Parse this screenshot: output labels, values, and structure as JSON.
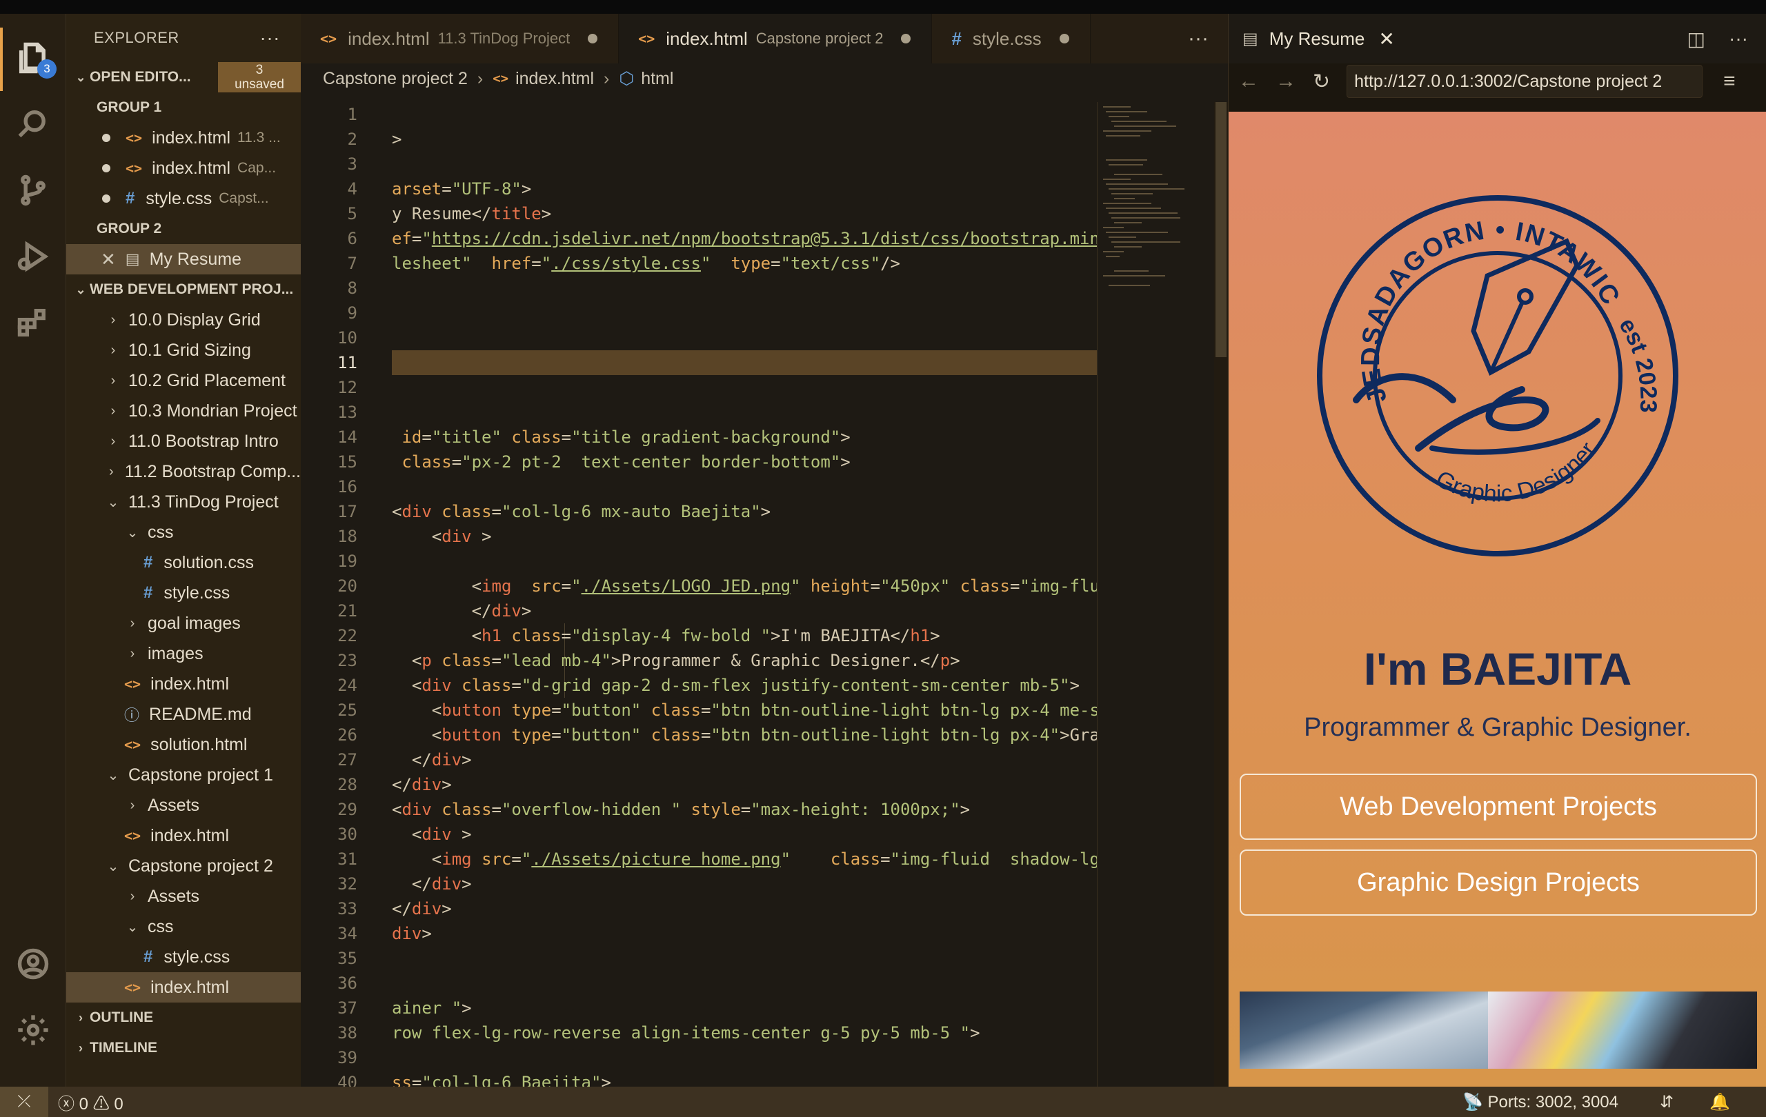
{
  "sidebar": {
    "title": "EXPLORER",
    "open_editors": {
      "label": "OPEN EDITO...",
      "unsaved_count": "3",
      "unsaved_label": "unsaved"
    },
    "group1": {
      "label": "GROUP 1",
      "items": [
        {
          "name": "index.html",
          "desc": "11.3 ..."
        },
        {
          "name": "index.html",
          "desc": "Cap..."
        },
        {
          "name": "style.css",
          "desc": "Capst..."
        }
      ]
    },
    "group2": {
      "label": "GROUP 2",
      "items": [
        {
          "name": "My Resume"
        }
      ]
    },
    "project": {
      "label": "WEB DEVELOPMENT PROJ..."
    },
    "tree": [
      "10.0 Display Grid",
      "10.1 Grid Sizing",
      "10.2 Grid Placement",
      "10.3 Mondrian Project",
      "11.0 Bootstrap Intro",
      "11.2 Bootstrap Comp...",
      "11.3 TinDog Project",
      "css",
      "solution.css",
      "style.css",
      "goal images",
      "images",
      "index.html",
      "README.md",
      "solution.html",
      "Capstone project 1",
      "Assets",
      "index.html",
      "Capstone project 2",
      "Assets",
      "css",
      "style.css",
      "index.html"
    ],
    "outline": "OUTLINE",
    "timeline": "TIMELINE",
    "explorer_badge": "3"
  },
  "tabs": [
    {
      "name": "index.html",
      "desc": "11.3 TinDog Project"
    },
    {
      "name": "index.html",
      "desc": "Capstone project 2"
    },
    {
      "name": "style.css",
      "desc": ""
    }
  ],
  "breadcrumb": {
    "folder": "Capstone project 2",
    "file": "index.html",
    "symbol": "html"
  },
  "code": {
    "current_line": 11,
    "line_numbers": [
      "1",
      "2",
      "3",
      "4",
      "5",
      "6",
      "7",
      "8",
      "9",
      "10",
      "11",
      "12",
      "13",
      "14",
      "15",
      "16",
      "17",
      "18",
      "19",
      "20",
      "21",
      "22",
      "23",
      "24",
      "25",
      "26",
      "27",
      "28",
      "29",
      "30",
      "31",
      "32",
      "33",
      "34",
      "35",
      "36",
      "37",
      "38",
      "39",
      "40"
    ]
  },
  "preview": {
    "tab_title": "My Resume",
    "url": "http://127.0.0.1:3002/Capstone project 2",
    "logo_top": "JEDSADAGORN • INTAWICHA",
    "logo_est": "est 2023",
    "logo_bottom": "Graphic Designer",
    "heading": "I'm BAEJITA",
    "lead": "Programmer & Graphic Designer.",
    "button1": "Web Development Projects",
    "button2": "Graphic Design Projects"
  },
  "status": {
    "errors": "0",
    "warnings": "0",
    "ports": "Ports: 3002, 3004"
  },
  "colors": {
    "accent": "#e8a24a",
    "badge": "#3a7bd5",
    "site_navy": "#1f2a4d"
  }
}
